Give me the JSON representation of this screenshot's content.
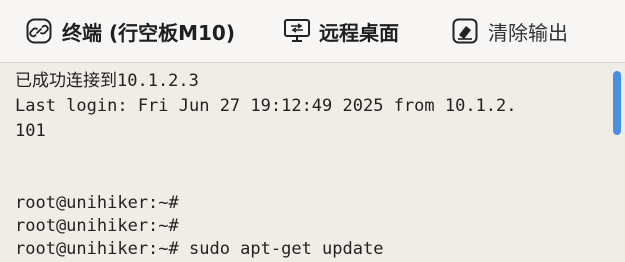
{
  "toolbar": {
    "terminal_label": "终端 (行空板M10)",
    "remote_desktop_label": "远程桌面",
    "clear_output_label": "清除输出",
    "terminal_icon": "link-icon",
    "remote_desktop_icon": "monitor-icon",
    "clear_output_icon": "eraser-icon"
  },
  "terminal": {
    "lines": [
      "已成功连接到10.1.2.3",
      "Last login: Fri Jun 27 19:12:49 2025 from 10.1.2.",
      "101",
      "",
      "",
      "root@unihiker:~#",
      "root@unihiker:~#",
      "root@unihiker:~# sudo apt-get update"
    ]
  },
  "colors": {
    "accent": "#4a90e2",
    "background": "#f0ede7",
    "toolbar_background": "#f7f6f4"
  }
}
